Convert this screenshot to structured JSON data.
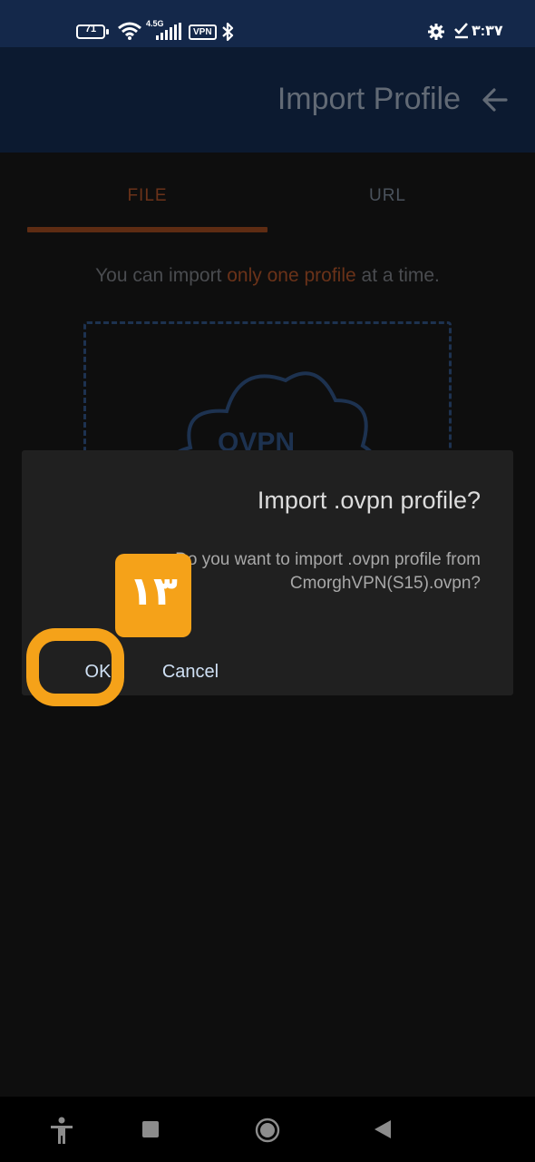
{
  "status_bar": {
    "battery_level": "71",
    "network_type": "4.5G",
    "vpn_label": "VPN",
    "time": "۳:۳۷",
    "icons": [
      "battery-icon",
      "wifi-icon",
      "signal-icon",
      "vpn-icon",
      "bluetooth-icon",
      "settings-icon",
      "check-icon"
    ]
  },
  "header": {
    "title": "Import Profile",
    "back_icon": "arrow-back-icon"
  },
  "tabs": [
    {
      "label": "FILE",
      "active": true
    },
    {
      "label": "URL",
      "active": false
    }
  ],
  "hint": {
    "before": "You can import ",
    "highlight": "only one profile",
    "after": " at a time."
  },
  "dropzone": {
    "icon": "cloud-icon",
    "label": "OVPN"
  },
  "dialog": {
    "title": "Import .ovpn profile?",
    "message_line1": "Do you want to import .ovpn profile from",
    "message_line2": "CmorghVPN(S15).ovpn?",
    "ok_label": "OK",
    "cancel_label": "Cancel"
  },
  "annotation": {
    "step_number": "۱۳"
  },
  "nav_bar": {
    "icons": [
      "accessibility-icon",
      "recents-icon",
      "home-icon",
      "back-icon"
    ]
  },
  "colors": {
    "status_bar": "#14284a",
    "app_bar": "#0c1a30",
    "accent_orange": "#f5a219",
    "dialog_bg": "#202020",
    "button_text": "#cfe0f4"
  }
}
